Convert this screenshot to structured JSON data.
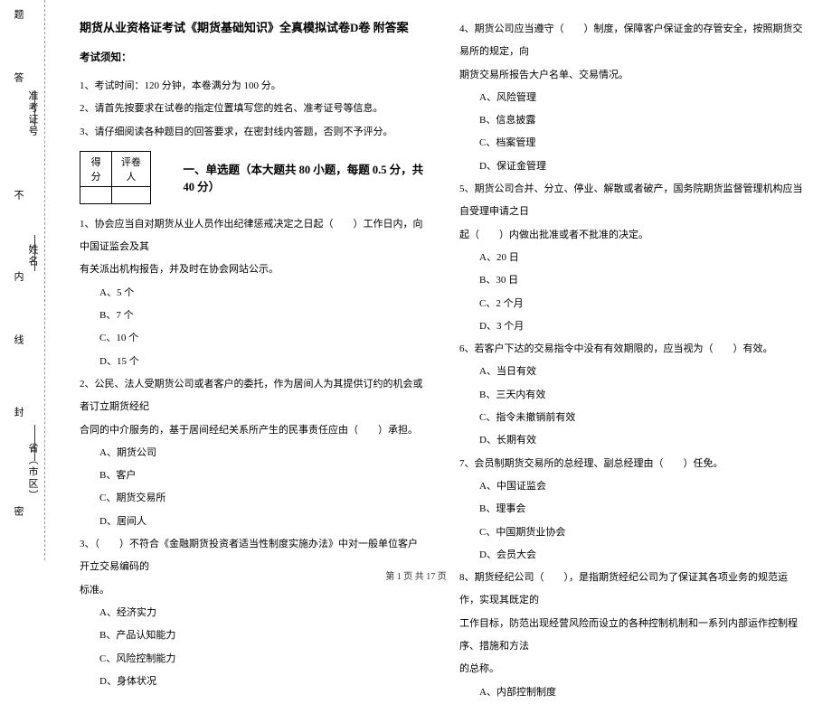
{
  "sidebar": {
    "labels": {
      "zone": "省（市区）",
      "name": "姓名",
      "ticket": "准考证号"
    },
    "marks": {
      "mi": "密",
      "feng": "封",
      "xian": "线",
      "nei": "内",
      "bu": "不",
      "da": "答",
      "ti": "题"
    }
  },
  "title": "期货从业资格证考试《期货基础知识》全真模拟试卷D卷 附答案",
  "notice_header": "考试须知：",
  "notices": [
    "1、考试时间：120 分钟，本卷满分为 100 分。",
    "2、请首先按要求在试卷的指定位置填写您的姓名、准考证号等信息。",
    "3、请仔细阅读各种题目的回答要求，在密封线内答题，否则不予评分。"
  ],
  "score": {
    "c1": "得分",
    "c2": "评卷人"
  },
  "section1": "一、单选题（本大题共 80 小题，每题 0.5 分，共 40 分）",
  "q1": {
    "stem1": "1、协会应当自对期货从业人员作出纪律惩戒决定之日起（　　）工作日内，向中国证监会及其",
    "stem2": "有关派出机构报告，并及时在协会网站公示。",
    "a": "A、5 个",
    "b": "B、7 个",
    "c": "C、10 个",
    "d": "D、15 个"
  },
  "q2": {
    "stem1": "2、公民、法人受期货公司或者客户的委托，作为居间人为其提供订约的机会或者订立期货经纪",
    "stem2": "合同的中介服务的，基于居间经纪关系所产生的民事责任应由（　　）承担。",
    "a": "A、期货公司",
    "b": "B、客户",
    "c": "C、期货交易所",
    "d": "D、居间人"
  },
  "q3": {
    "stem1": "3、（　　）不符合《金融期货投资者适当性制度实施办法》中对一般单位客户开立交易编码的",
    "stem2": "标准。",
    "a": "A、经济实力",
    "b": "B、产品认知能力",
    "c": "C、风险控制能力",
    "d": "D、身体状况"
  },
  "q4": {
    "stem1": "4、期货公司应当遵守（　　）制度，保障客户保证金的存管安全，按照期货交易所的规定，向",
    "stem2": "期货交易所报告大户名单、交易情况。",
    "a": "A、风险管理",
    "b": "B、信息披露",
    "c": "C、档案管理",
    "d": "D、保证金管理"
  },
  "q5": {
    "stem1": "5、期货公司合并、分立、停业、解散或者破产，国务院期货监督管理机构应当自受理申请之日",
    "stem2": "起（　　）内做出批准或者不批准的决定。",
    "a": "A、20 日",
    "b": "B、30 日",
    "c": "C、2 个月",
    "d": "D、3 个月"
  },
  "q6": {
    "stem": "6、若客户下达的交易指令中没有有效期限的，应当视为（　　）有效。",
    "a": "A、当日有效",
    "b": "B、三天内有效",
    "c": "C、指令未撤销前有效",
    "d": "D、长期有效"
  },
  "q7": {
    "stem": "7、会员制期货交易所的总经理、副总经理由（　　）任免。",
    "a": "A、中国证监会",
    "b": "B、理事会",
    "c": "C、中国期货业协会",
    "d": "D、会员大会"
  },
  "q8": {
    "stem1": "8、期货经纪公司（　　），是指期货经纪公司为了保证其各项业务的规范运作，实现其既定的",
    "stem2": "工作目标，防范出现经营风险而设立的各种控制机制和一系列内部运作控制程序、措施和方法",
    "stem3": "的总称。",
    "a": "A、内部控制制度"
  },
  "footer": "第 1 页 共 17 页"
}
